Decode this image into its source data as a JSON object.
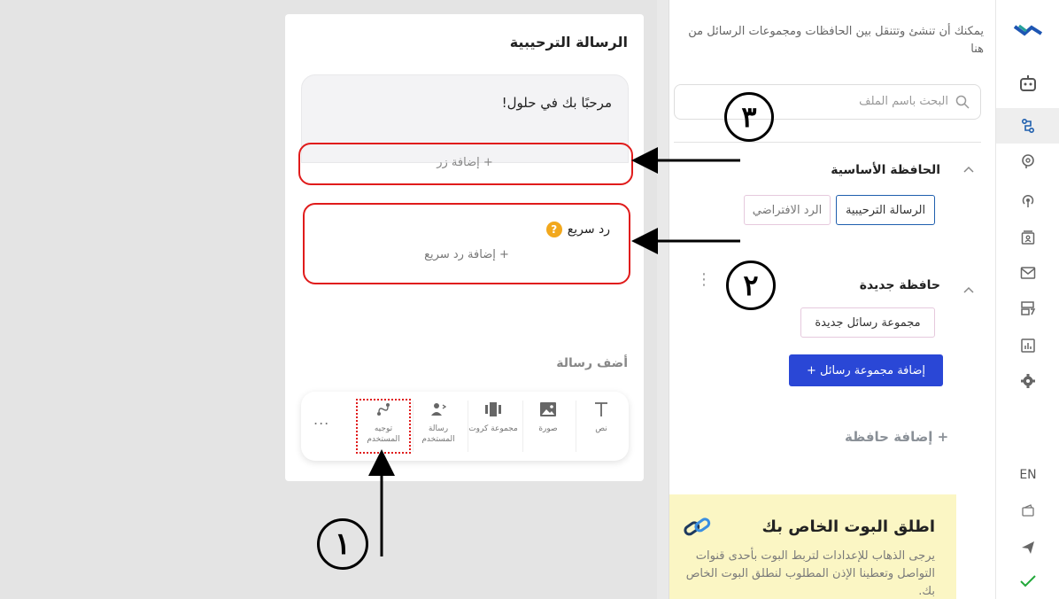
{
  "sidebar": {
    "icons": [
      "logo-icon",
      "bot-icon",
      "flow-icon",
      "brain-icon",
      "broadcast-icon",
      "contacts-icon",
      "mail-icon",
      "templates-icon",
      "analytics-icon",
      "settings-icon"
    ],
    "language": "EN",
    "bottom_icons": [
      "wallet-icon",
      "send-icon",
      "check-icon"
    ]
  },
  "folders_panel": {
    "hint": "يمكنك أن تنشئ وتتنقل بين الحافظات ومجموعات الرسائل من هنا",
    "search_placeholder": "البحث باسم الملف",
    "main_folder": {
      "title": "الحافظة الأساسية",
      "chips": [
        "الرسالة الترحيبية",
        "الرد الافتراضي"
      ]
    },
    "new_folder": {
      "title": "حافظة جديدة",
      "chips": [
        "مجموعة رسائل جديدة"
      ]
    },
    "add_group_button": "إضافة مجموعة رسائل +",
    "add_folder": "+ إضافة حافظة",
    "bot_card": {
      "title": "اطلق البوت الخاص بك",
      "body": "يرجى الذهاب للإعدادات لتربط البوت بأحدى قنوات التواصل وتعطينا الإذن المطلوب لنطلق البوت الخاص بك."
    }
  },
  "editor": {
    "title": "الرسالة الترحيبية",
    "message_text": "مرحبًا بك في حلول!",
    "add_button": "+ إضافة زر",
    "quick_reply_label": "رد سريع",
    "add_quick_reply": "+ إضافة رد سريع",
    "add_message_label": "أضف رسالة",
    "tools": [
      {
        "label": "نص",
        "icon": "text-icon"
      },
      {
        "label": "صورة",
        "icon": "image-icon"
      },
      {
        "label": "مجموعة كروت",
        "icon": "cards-icon"
      },
      {
        "label": "رسالة المستخدم",
        "icon": "user-message-icon"
      },
      {
        "label": "توجيه المستخدم",
        "icon": "redirect-icon"
      }
    ],
    "more": "..."
  },
  "annotations": {
    "one": "١",
    "two": "٢",
    "three": "٣"
  },
  "colors": {
    "accent": "#2a47d6",
    "selected_border": "#1f5fae",
    "annotation_red": "#e01b1b",
    "bot_card_bg": "#fbf6c4",
    "active_check": "#22a83a"
  }
}
